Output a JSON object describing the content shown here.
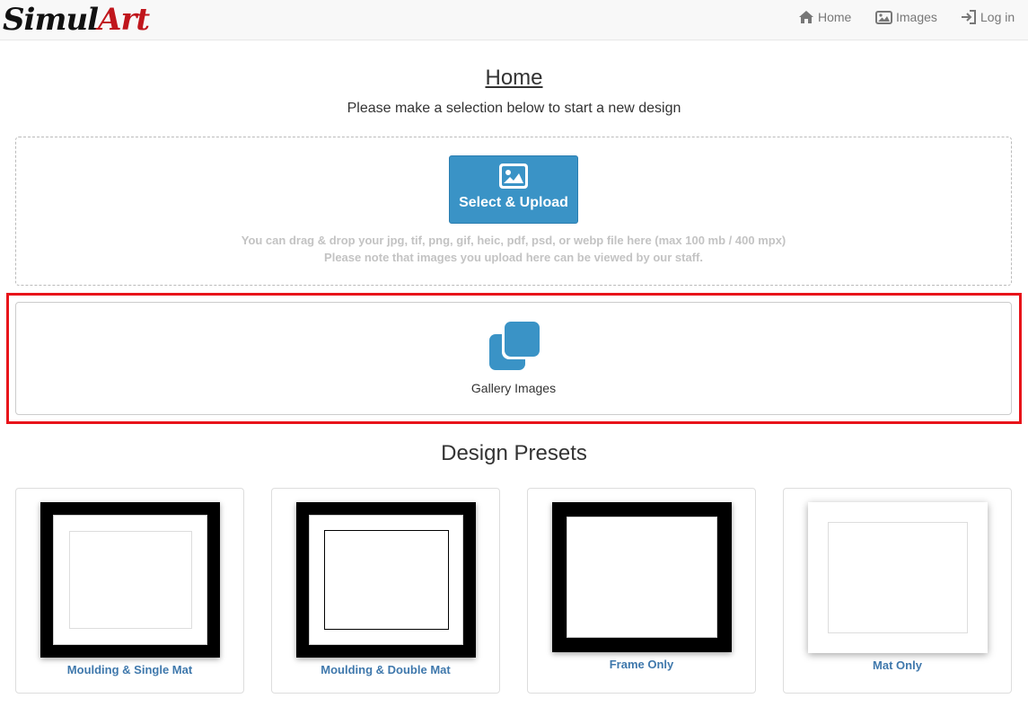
{
  "nav": {
    "brand_part1": "Simul",
    "brand_part2": "Art",
    "brand_color": "#c0161c",
    "items": [
      {
        "label": "Home",
        "icon": "home-icon"
      },
      {
        "label": "Images",
        "icon": "images-icon"
      },
      {
        "label": "Log in",
        "icon": "login-icon"
      }
    ]
  },
  "page": {
    "title": "Home",
    "subtitle": "Please make a selection below to start a new design"
  },
  "upload": {
    "button_label": "Select & Upload",
    "button_icon": "image-icon",
    "button_color": "#3a93c6",
    "note_line1": "You can drag & drop your jpg, tif, png, gif, heic, pdf, psd, or webp file here (max 100 mb / 400 mpx)",
    "note_line2": "Please note that images you upload here can be viewed by our staff."
  },
  "gallery": {
    "label": "Gallery Images",
    "icon": "gallery-icon",
    "highlight_color": "#e8141a"
  },
  "presets": {
    "title": "Design Presets",
    "items": [
      {
        "label": "Moulding & Single Mat",
        "preview": "frame-single-mat"
      },
      {
        "label": "Moulding & Double Mat",
        "preview": "frame-double-mat"
      },
      {
        "label": "Frame Only",
        "preview": "frame-only"
      },
      {
        "label": "Mat Only",
        "preview": "mat-only"
      }
    ]
  }
}
